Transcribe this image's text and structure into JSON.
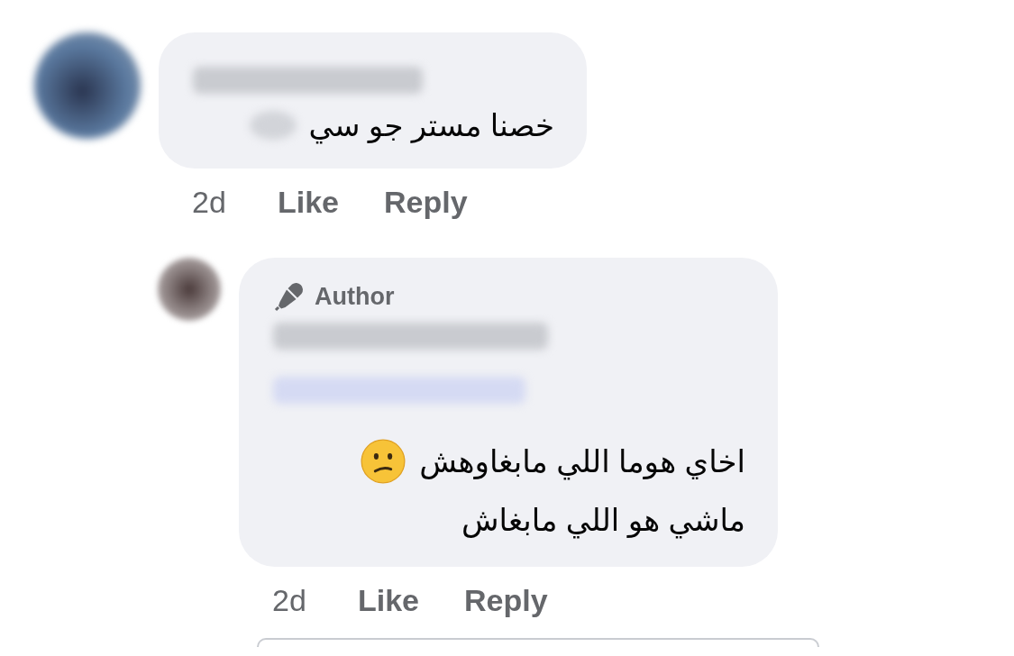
{
  "comments": [
    {
      "redacted_name": true,
      "lines": [
        {
          "text": "خصنا مستر جو سي",
          "redacted_tail": true
        }
      ],
      "time": "2d",
      "like": "Like",
      "reply": "Reply",
      "replies": [
        {
          "redacted_name": true,
          "author_badge": "Author",
          "redacted_mention": true,
          "lines": [
            {
              "text": "اخاي هوما اللي مابغاوهش",
              "trailing_emoji": true
            },
            {
              "text": "ماشي هو اللي مابغاش"
            }
          ],
          "time": "2d",
          "like": "Like",
          "reply": "Reply"
        }
      ]
    }
  ],
  "reply_field": {
    "shown": true
  }
}
